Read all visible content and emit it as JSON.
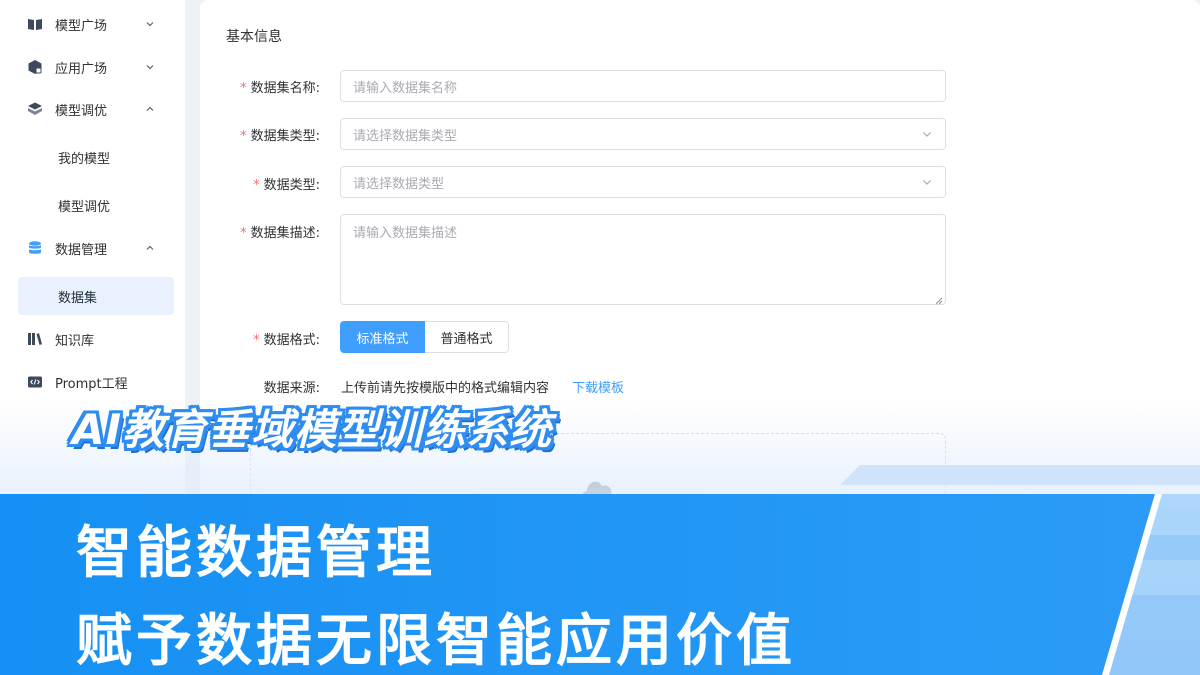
{
  "sidebar": {
    "items": [
      {
        "label": "模型广场",
        "icon": "book-icon",
        "chevron": "down"
      },
      {
        "label": "应用广场",
        "icon": "app-store-icon",
        "chevron": "down"
      },
      {
        "label": "模型调优",
        "icon": "cube-icon",
        "chevron": "up"
      },
      {
        "label": "我的模型"
      },
      {
        "label": "模型调优"
      },
      {
        "label": "数据管理",
        "icon": "database-icon",
        "chevron": "up"
      },
      {
        "label": "数据集",
        "active": true
      },
      {
        "label": "知识库",
        "icon": "library-icon"
      },
      {
        "label": "Prompt工程",
        "icon": "code-icon"
      }
    ]
  },
  "form": {
    "section_title": "基本信息",
    "required_mark": "*",
    "name_label": "数据集名称:",
    "name_placeholder": "请输入数据集名称",
    "type_label": "数据集类型:",
    "type_placeholder": "请选择数据集类型",
    "data_type_label": "数据类型:",
    "data_type_placeholder": "请选择数据类型",
    "desc_label": "数据集描述:",
    "desc_placeholder": "请输入数据集描述",
    "format_label": "数据格式:",
    "format_options": [
      "标准格式",
      "普通格式"
    ],
    "format_selected": "标准格式",
    "source_label": "数据来源:",
    "source_text": "上传前请先按模版中的格式编辑内容",
    "source_link": "下载模板"
  },
  "overlay": {
    "headline": "AI教育垂域模型训练系统",
    "line1": "智能数据管理",
    "line2": "赋予数据无限智能应用价值"
  },
  "colors": {
    "primary": "#409eff",
    "required": "#f56c6c",
    "banner": "#1a8cf0",
    "headline_outline": "#2f8cf0"
  }
}
